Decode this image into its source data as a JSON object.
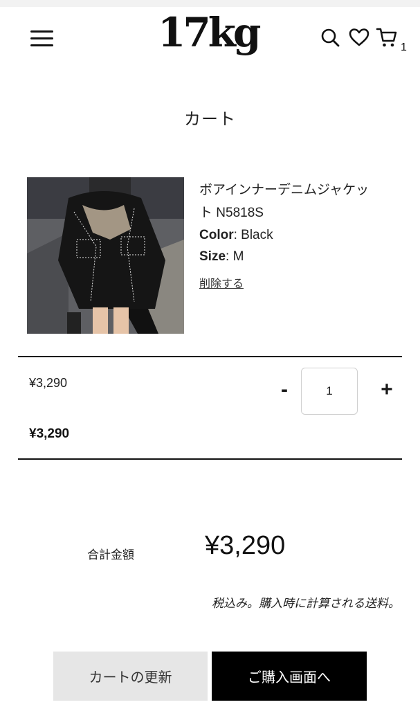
{
  "header": {
    "logo": "17kg",
    "cart_count": "1"
  },
  "page_title": "カート",
  "item": {
    "name": "ボアインナーデニムジャケット N5818S",
    "color_label": "Color",
    "color_value": ": Black",
    "size_label": "Size",
    "size_value": ": M",
    "remove_label": "削除する",
    "unit_price": "¥3,290",
    "line_total": "¥3,290",
    "quantity": "1",
    "minus_label": "-",
    "plus_label": "+"
  },
  "summary": {
    "subtotal_label": "合計金額",
    "subtotal_value": "¥3,290",
    "tax_note": "税込み。購入時に計算される送料。"
  },
  "buttons": {
    "update_label": "カートの更新",
    "checkout_label": "ご購入画面へ"
  }
}
